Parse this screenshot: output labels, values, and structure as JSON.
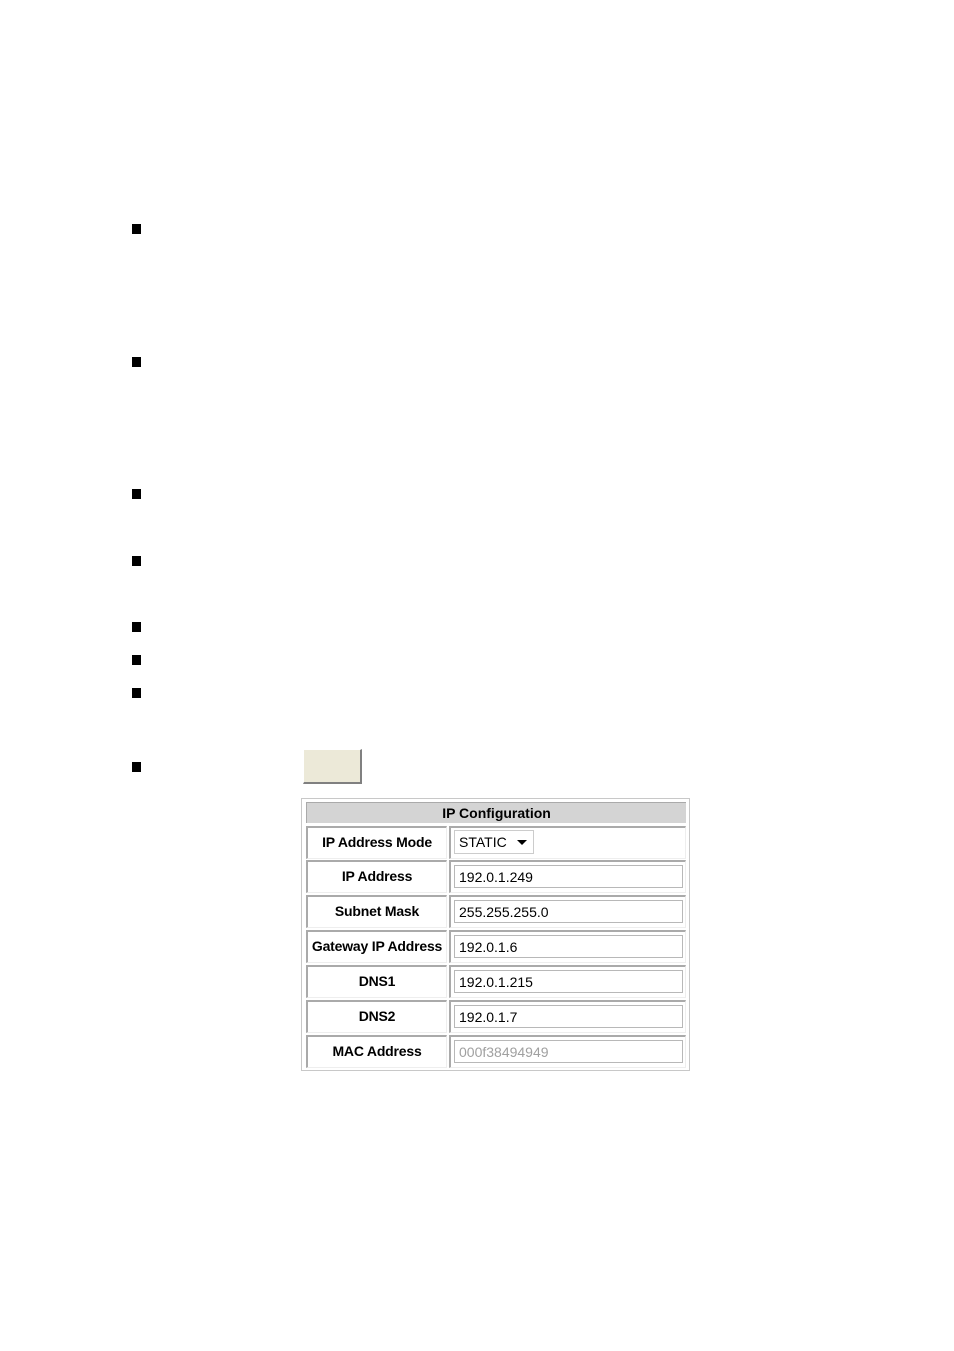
{
  "bullets": 8,
  "apply_button": {
    "label": ""
  },
  "ip_config": {
    "title": "IP Configuration",
    "mode": {
      "label": "IP Address Mode",
      "value": "STATIC"
    },
    "rows": [
      {
        "label": "IP Address",
        "value": "192.0.1.249",
        "disabled": false
      },
      {
        "label": "Subnet Mask",
        "value": "255.255.255.0",
        "disabled": false
      },
      {
        "label": "Gateway IP Address",
        "value": "192.0.1.6",
        "disabled": false
      },
      {
        "label": "DNS1",
        "value": "192.0.1.215",
        "disabled": false
      },
      {
        "label": "DNS2",
        "value": "192.0.1.7",
        "disabled": false
      },
      {
        "label": "MAC Address",
        "value": "000f38494949",
        "disabled": true
      }
    ]
  }
}
